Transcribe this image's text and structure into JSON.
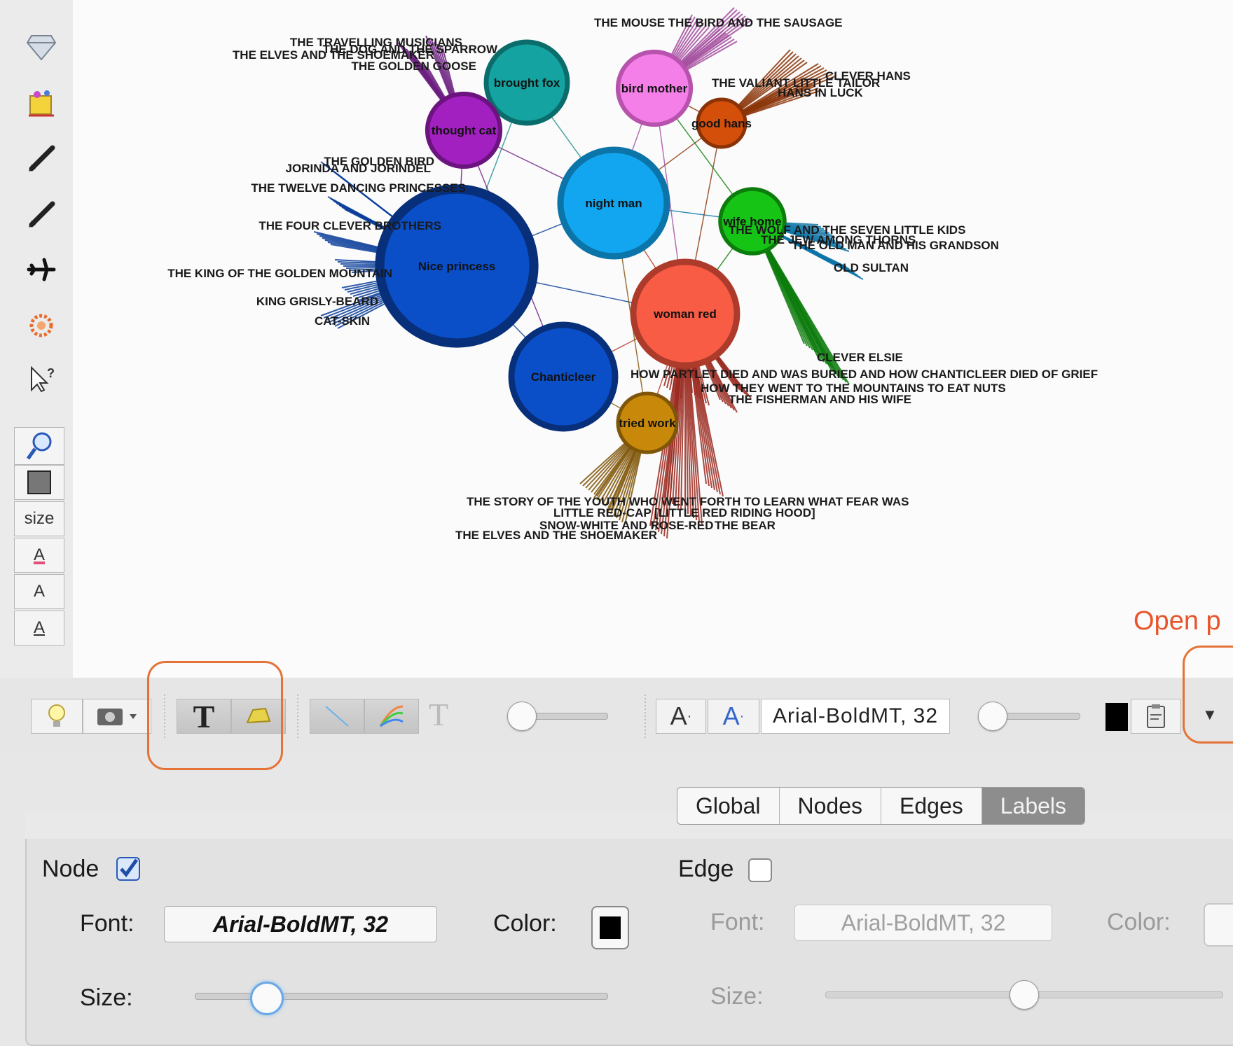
{
  "graph": {
    "nodes": [
      {
        "label": "brought fox",
        "color": "#14a3a0",
        "stroke": "#0b6d6b"
      },
      {
        "label": "bird mother",
        "color": "#f47fe9",
        "stroke": "#b853ad"
      },
      {
        "label": "thought cat",
        "color": "#a21fc0",
        "stroke": "#6b137f"
      },
      {
        "label": "good hans",
        "color": "#d4500a",
        "stroke": "#8a3306"
      },
      {
        "label": "night man",
        "color": "#12a6f0",
        "stroke": "#0b74a8"
      },
      {
        "label": "wife home",
        "color": "#16c416",
        "stroke": "#0c7c0c"
      },
      {
        "label": "Nice princess",
        "color": "#0b4fc8",
        "stroke": "#072f7a"
      },
      {
        "label": "woman red",
        "color": "#f85c44",
        "stroke": "#ad3b2b"
      },
      {
        "label": "Chanticleer",
        "color": "#0b4fc8",
        "stroke": "#072f7a"
      },
      {
        "label": "tried work",
        "color": "#c8890b",
        "stroke": "#7f5507"
      }
    ],
    "titles": [
      "THE MOUSE THE BIRD AND THE SAUSAGE",
      "THE TRAVELLING MUSICIANS",
      "THE DOG AND THE SPARROW",
      "THE ELVES AND THE SHOEMAKER",
      "THE GOLDEN GOOSE",
      "CLEVER HANS",
      "THE VALIANT LITTLE TAILOR",
      "HANS IN LUCK",
      "THE GOLDEN BIRD",
      "JORINDA AND JORINDEL",
      "THE TWELVE DANCING PRINCESSES",
      "THE FOUR CLEVER BROTHERS",
      "THE KING OF THE GOLDEN MOUNTAIN",
      "KING GRISLY-BEARD",
      "CAT-SKIN",
      "THE WOLF AND THE SEVEN LITTLE KIDS",
      "THE JEW AMONG THORNS",
      "THE OLD MAN AND HIS GRANDSON",
      "OLD SULTAN",
      "CLEVER ELSIE",
      "HOW PARTLET DIED AND WAS BURIED AND HOW CHANTICLEER DIED OF GRIEF",
      "HOW THEY WENT TO THE MOUNTAINS TO EAT NUTS",
      "THE FISHERMAN AND HIS WIFE",
      "THE STORY OF THE YOUTH WHO WENT FORTH TO LEARN WHAT FEAR WAS",
      "LITTLE RED-CAP [LITTLE RED RIDING HOOD]",
      "SNOW-WHITE AND ROSE-RED",
      "THE BEAR",
      "THE ELVES AND THE SHOEMAKER"
    ]
  },
  "left_tools": {
    "size_label": "size",
    "a1": "A",
    "a2": "A",
    "a3": "A"
  },
  "toolbar": {
    "text_tool": "T",
    "font_inc": "A",
    "font_dec": "A",
    "font_value": "Arial-BoldMT, 32",
    "gray_t": "T"
  },
  "annotation": "Open p",
  "tabs": [
    "Global",
    "Nodes",
    "Edges",
    "Labels"
  ],
  "active_tab": "Labels",
  "labels_panel": {
    "node": {
      "label": "Node",
      "checked": true,
      "font_label": "Font:",
      "font_value": "Arial-BoldMT, 32",
      "color_label": "Color:",
      "color": "#000000",
      "size_label": "Size:",
      "size_fraction": 0.17
    },
    "edge": {
      "label": "Edge",
      "checked": false,
      "font_label": "Font:",
      "font_value": "Arial-BoldMT, 32",
      "color_label": "Color:",
      "size_label": "Size:",
      "size_fraction": 0.5
    }
  },
  "colors": {
    "highlight": "#e57236",
    "annotation": "#e8542c"
  }
}
